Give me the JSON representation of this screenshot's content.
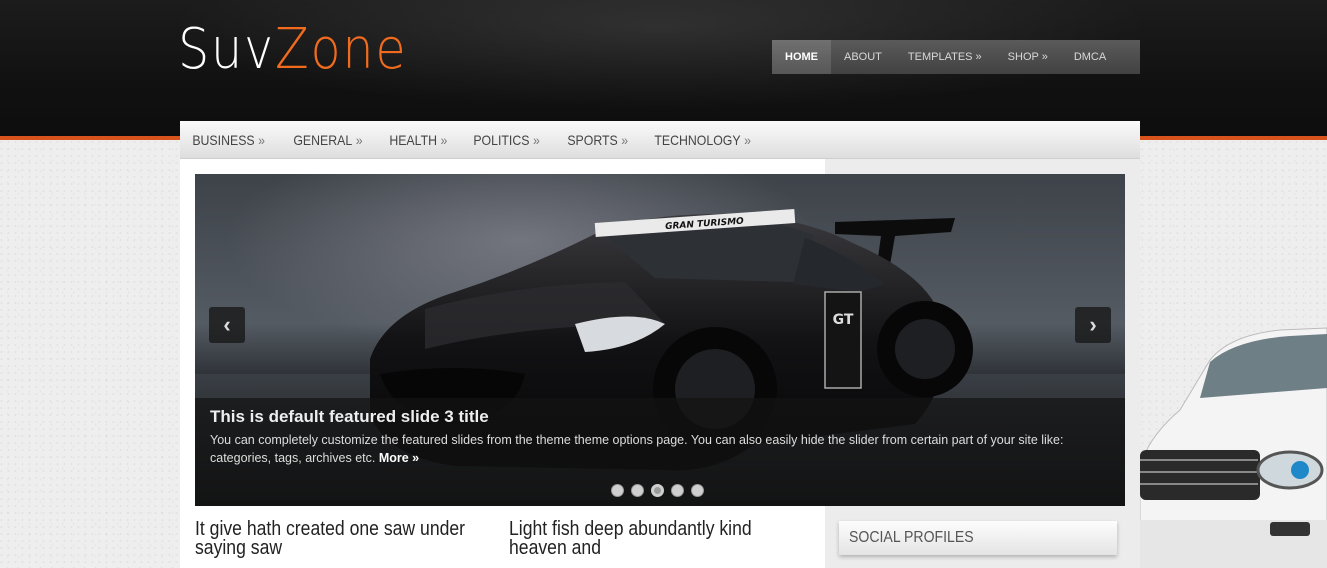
{
  "site": {
    "logo_part1": "Suv",
    "logo_part2": "Zone",
    "accent_color": "#f06b1e"
  },
  "top_nav": [
    {
      "label": "HOME",
      "active": true
    },
    {
      "label": "ABOUT",
      "active": false
    },
    {
      "label": "TEMPLATES »",
      "active": false
    },
    {
      "label": "SHOP »",
      "active": false
    },
    {
      "label": "DMCA",
      "active": false
    }
  ],
  "category_nav": [
    {
      "label": "BUSINESS"
    },
    {
      "label": "GENERAL"
    },
    {
      "label": "HEALTH"
    },
    {
      "label": "POLITICS"
    },
    {
      "label": "SPORTS"
    },
    {
      "label": "TECHNOLOGY"
    }
  ],
  "category_nav_suffix": "»",
  "slider": {
    "title": "This is default featured slide 3 title",
    "text": "You can completely customize the featured slides from the theme theme options page. You can also easily hide the slider from certain part of your site like: categories, tags, archives etc.",
    "more_label": "More »",
    "prev_icon": "chevron-left-icon",
    "next_icon": "chevron-right-icon",
    "dot_count": 5,
    "active_dot": 3
  },
  "posts": [
    {
      "title": "It give hath created one saw under saying saw"
    },
    {
      "title": "Light fish deep abundantly kind heaven and"
    }
  ],
  "sidebar": {
    "widget_title": "SOCIAL PROFILES"
  }
}
